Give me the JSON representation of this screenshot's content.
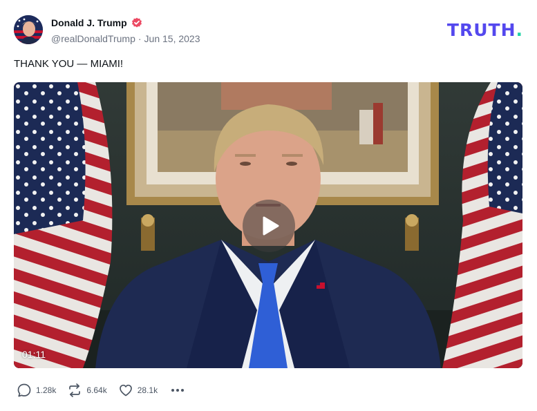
{
  "author": {
    "name": "Donald J. Trump",
    "handle": "@realDonaldTrump",
    "separator": "·",
    "date": "Jun 15, 2023"
  },
  "brand": {
    "text": "TRUTH",
    "dot": ".",
    "color": "#5448ee",
    "dot_color": "#1fd3a6"
  },
  "post": {
    "text": "THANK YOU — MIAMI!"
  },
  "video": {
    "duration": "01:11",
    "play_icon": "play-icon"
  },
  "actions": {
    "replies": "1.28k",
    "retruths": "6.64k",
    "likes": "28.1k",
    "reply_icon": "reply-icon",
    "retruth_icon": "retruth-icon",
    "like_icon": "heart-icon",
    "more_icon": "more-icon"
  },
  "colors": {
    "verified_badge": "#ec4a63",
    "text_primary": "#0f1419",
    "text_secondary": "#6b7280"
  }
}
